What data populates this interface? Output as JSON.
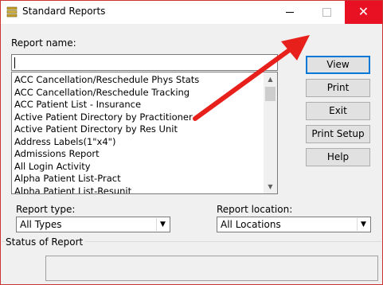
{
  "window": {
    "title": "Standard Reports",
    "close_glyph": "✕"
  },
  "report_name": {
    "label": "Report name:",
    "value": ""
  },
  "report_list": {
    "items": [
      "ACC Cancellation/Reschedule Phys Stats",
      "ACC Cancellation/Reschedule Tracking",
      "ACC Patient List - Insurance",
      "Active Patient Directory by Practitioner",
      "Active Patient Directory by Res Unit",
      "Address Labels(1\"x4\")",
      "Admissions Report",
      "All Login Activity",
      "Alpha Patient List-Pract",
      "Alpha Patient List-Resunit"
    ]
  },
  "buttons": {
    "view": "View",
    "print": "Print",
    "exit": "Exit",
    "print_setup": "Print Setup",
    "help": "Help"
  },
  "report_type": {
    "label": "Report type:",
    "value": "All Types"
  },
  "report_location": {
    "label": "Report location:",
    "value": "All Locations"
  },
  "status": {
    "label": "Status of Report",
    "value": ""
  },
  "colors": {
    "close_bg": "#e81123",
    "annotation_arrow": "#e8201c",
    "default_button_border": "#0078d7"
  },
  "icons": {
    "app": "report-stack-icon",
    "minimize": "minimize-icon",
    "maximize": "maximize-icon",
    "close": "close-icon",
    "scroll_up": "chevron-up-icon",
    "scroll_down": "chevron-down-icon",
    "dropdown": "chevron-down-icon",
    "annotation": "annotation-arrow-icon"
  }
}
